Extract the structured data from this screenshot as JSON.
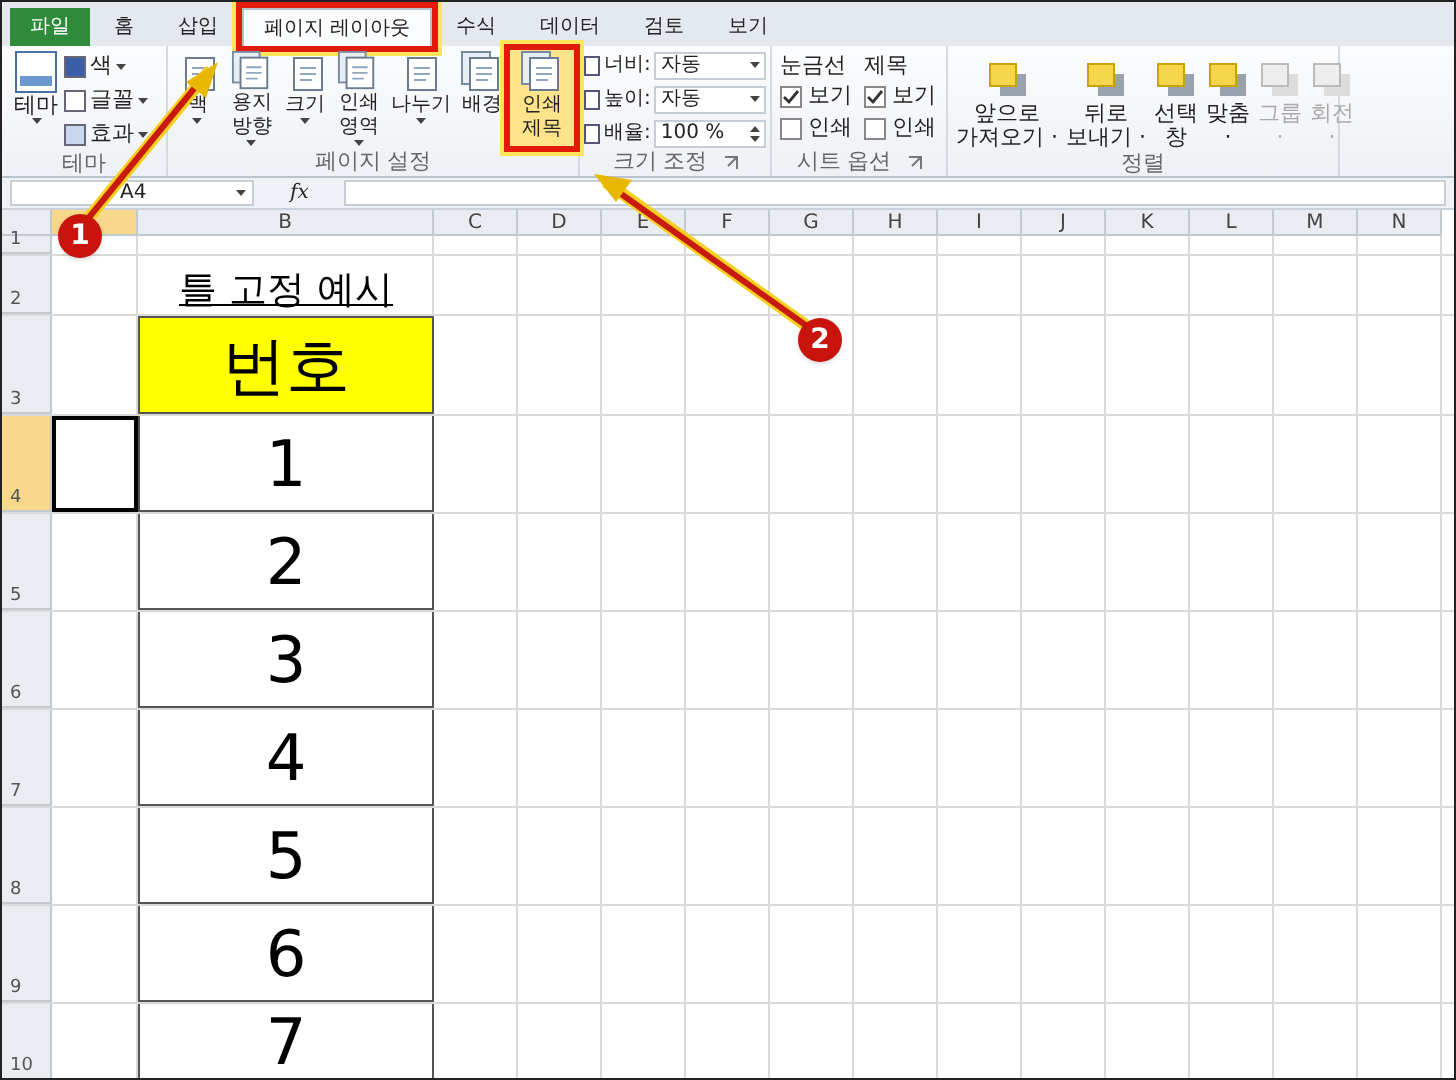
{
  "tabs": [
    {
      "label": "파일",
      "kind": "file",
      "selected": false,
      "highlighted": false
    },
    {
      "label": "홈",
      "kind": "tab",
      "selected": false,
      "highlighted": false
    },
    {
      "label": "삽입",
      "kind": "tab",
      "selected": false,
      "highlighted": false
    },
    {
      "label": "페이지 레이아웃",
      "kind": "tab",
      "selected": true,
      "highlighted": true
    },
    {
      "label": "수식",
      "kind": "tab",
      "selected": false,
      "highlighted": false
    },
    {
      "label": "데이터",
      "kind": "tab",
      "selected": false,
      "highlighted": false
    },
    {
      "label": "검토",
      "kind": "tab",
      "selected": false,
      "highlighted": false
    },
    {
      "label": "보기",
      "kind": "tab",
      "selected": false,
      "highlighted": false
    }
  ],
  "ribbon": {
    "theme_group": {
      "label": "테마",
      "main": {
        "lines": [
          "테마"
        ],
        "dropdown": true
      },
      "items": [
        "색",
        "글꼴",
        "효과"
      ]
    },
    "page_setup": {
      "label": "페이지 설정",
      "buttons": [
        {
          "lines": [
            "백"
          ],
          "dropdown": true,
          "highlighted": false
        },
        {
          "lines": [
            "용지",
            "방향"
          ],
          "dropdown": true,
          "highlighted": false
        },
        {
          "lines": [
            "크기"
          ],
          "dropdown": true,
          "highlighted": false
        },
        {
          "lines": [
            "인쇄",
            "영역"
          ],
          "dropdown": true,
          "highlighted": false
        },
        {
          "lines": [
            "나누기"
          ],
          "dropdown": true,
          "highlighted": false
        },
        {
          "lines": [
            "배경"
          ],
          "dropdown": false,
          "highlighted": false
        },
        {
          "lines": [
            "인쇄",
            "제목"
          ],
          "dropdown": false,
          "highlighted": true
        }
      ]
    },
    "scale": {
      "label": "크기 조정",
      "launcher": true,
      "fields": [
        {
          "label": "너비:",
          "value": "자동",
          "kind": "select"
        },
        {
          "label": "높이:",
          "value": "자동",
          "kind": "select"
        },
        {
          "label": "배율:",
          "value": "100 %",
          "kind": "spin"
        }
      ]
    },
    "sheet_options": {
      "label": "시트 옵션",
      "launcher": true,
      "columns": [
        {
          "title": "눈금선",
          "options": [
            {
              "label": "보기",
              "checked": true
            },
            {
              "label": "인쇄",
              "checked": false
            }
          ]
        },
        {
          "title": "제목",
          "options": [
            {
              "label": "보기",
              "checked": true
            },
            {
              "label": "인쇄",
              "checked": false
            }
          ]
        }
      ]
    },
    "arrange": {
      "label": "정렬",
      "buttons": [
        {
          "lines": [
            "앞으로",
            "가져오기 ·"
          ],
          "disabled": false
        },
        {
          "lines": [
            "뒤로",
            "보내기 ·"
          ],
          "disabled": false
        },
        {
          "lines": [
            "선택",
            "창"
          ],
          "disabled": false
        },
        {
          "lines": [
            "맞춤",
            "·"
          ],
          "disabled": false
        },
        {
          "lines": [
            "그룹",
            "·"
          ],
          "disabled": true
        },
        {
          "lines": [
            "회전",
            "·"
          ],
          "disabled": true
        }
      ]
    }
  },
  "formula_bar": {
    "name_box": "A4",
    "function_button": "fx"
  },
  "columns": [
    {
      "selected": true
    },
    {
      "label": "B",
      "selected": false
    },
    {
      "label": "C",
      "selected": false
    },
    {
      "label": "D",
      "selected": false
    },
    {
      "label": "E",
      "selected": false
    },
    {
      "label": "F",
      "selected": false
    },
    {
      "label": "G",
      "selected": false
    },
    {
      "label": "H",
      "selected": false
    },
    {
      "label": "I",
      "selected": false
    },
    {
      "label": "J",
      "selected": false
    },
    {
      "label": "K",
      "selected": false
    },
    {
      "label": "L",
      "selected": false
    },
    {
      "label": "M",
      "selected": false
    },
    {
      "label": "N",
      "selected": false
    }
  ],
  "rows": [
    {
      "label": "1",
      "selected": false,
      "cells": []
    },
    {
      "label": "2",
      "selected": false,
      "cells": [
        {
          "kind": "empty"
        },
        {
          "text": "틀 고정 예시",
          "kind": "title"
        }
      ]
    },
    {
      "label": "3",
      "selected": false,
      "cells": [
        {
          "kind": "empty"
        },
        {
          "text": "번호",
          "kind": "header"
        }
      ]
    },
    {
      "label": "4",
      "selected": true,
      "cells": [
        {
          "kind": "active"
        },
        {
          "text": "1",
          "kind": "number"
        }
      ]
    },
    {
      "label": "5",
      "selected": false,
      "cells": [
        {
          "kind": "empty"
        },
        {
          "text": "2",
          "kind": "number"
        }
      ]
    },
    {
      "label": "6",
      "selected": false,
      "cells": [
        {
          "kind": "empty"
        },
        {
          "text": "3",
          "kind": "number"
        }
      ]
    },
    {
      "label": "7",
      "selected": false,
      "cells": [
        {
          "kind": "empty"
        },
        {
          "text": "4",
          "kind": "number"
        }
      ]
    },
    {
      "label": "8",
      "selected": false,
      "cells": [
        {
          "kind": "empty"
        },
        {
          "text": "5",
          "kind": "number"
        }
      ]
    },
    {
      "label": "9",
      "selected": false,
      "cells": [
        {
          "kind": "empty"
        },
        {
          "text": "6",
          "kind": "number"
        }
      ]
    },
    {
      "label": "10",
      "selected": false,
      "cells": [
        {
          "kind": "empty"
        },
        {
          "text": "7",
          "kind": "number"
        }
      ]
    }
  ],
  "annotations": [
    {
      "number": "1"
    },
    {
      "number": "2"
    }
  ]
}
